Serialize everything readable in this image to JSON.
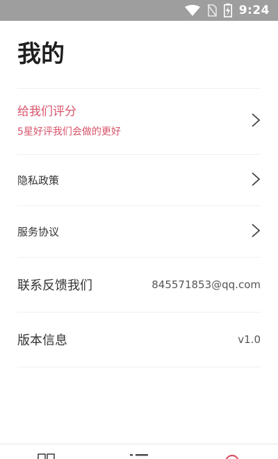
{
  "status_bar": {
    "time": "9:24",
    "icons": [
      "wifi-icon",
      "no-sim-icon",
      "battery-charging-icon"
    ]
  },
  "page": {
    "title": "我的"
  },
  "menu": {
    "rate": {
      "title": "给我们评分",
      "subtitle": "5星好评我们会做的更好",
      "icon": "chevron-right-icon"
    },
    "privacy": {
      "label": "隐私政策",
      "icon": "chevron-right-icon"
    },
    "terms": {
      "label": "服务协议",
      "icon": "chevron-right-icon"
    },
    "contact": {
      "label": "联系反馈我们",
      "value": "845571853@qq.com"
    },
    "version": {
      "label": "版本信息",
      "value": "v1.0"
    }
  },
  "bottom_nav": {
    "items": [
      {
        "icon": "grid-icon"
      },
      {
        "icon": "list-icon"
      },
      {
        "icon": "profile-icon",
        "active": true
      }
    ],
    "active_color": "#d9546a"
  },
  "colors": {
    "accent": "#d9546a",
    "status_bar": "#9e9e9e",
    "text": "#333333"
  }
}
